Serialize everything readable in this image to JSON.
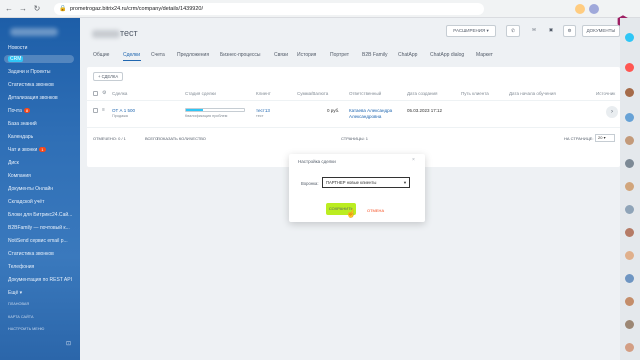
{
  "browser": {
    "url": "prometrogaz.bitrix24.ru/crm/company/details/1439920/"
  },
  "sidebar": {
    "items": [
      {
        "label": "Новости"
      },
      {
        "label": "CRM",
        "tag": "CRM"
      },
      {
        "label": "Задачи и Проекты"
      },
      {
        "label": "Статистика звонков"
      },
      {
        "label": "Детализация звонков"
      },
      {
        "label": "Почта",
        "badge": "8"
      },
      {
        "label": "База знаний"
      },
      {
        "label": "Календарь"
      },
      {
        "label": "Чат и звонки",
        "badge": "1"
      },
      {
        "label": "Диск"
      },
      {
        "label": "Компания"
      },
      {
        "label": "Документы Онлайн"
      },
      {
        "label": "Складской учёт"
      },
      {
        "label": "Блоки для Битрикс24.Сай..."
      },
      {
        "label": "B2BFamily — почтовый к..."
      },
      {
        "label": "NotiSend сервис email р..."
      },
      {
        "label": "Статистика звонков"
      },
      {
        "label": "Телефония"
      },
      {
        "label": "Документация по REST API"
      },
      {
        "label": "Ещё"
      }
    ],
    "footer": [
      "ПЛАНОВАЯ",
      "КАРТА САЙТА",
      "НАСТРОИТЬ МЕНЮ"
    ]
  },
  "header": {
    "title": "тест",
    "extensions_label": "РАСШИРЕНИЯ",
    "documents_label": "ДОКУМЕНТЫ"
  },
  "tabs": [
    "Общие",
    "Сделки",
    "Счета",
    "Предложения",
    "Бизнес-процессы",
    "Связи",
    "История",
    "Портрет",
    "B2B Family",
    "ChatApp",
    "ChatApp dialog",
    "Маркет"
  ],
  "active_tab": "Сделки",
  "deals": {
    "add_label": "СДЕЛКА",
    "columns": [
      "Сделка",
      "Стадия сделки",
      "Клиент",
      "Сумма/Валюта",
      "Ответственный",
      "Дата создания",
      "Путь клиента",
      "Дата начала обучения",
      "Источник"
    ],
    "row": {
      "deal_name": "ОТ А 1 500",
      "deal_sub": "Продажа",
      "stage": "Квалификация проблем",
      "stage_progress": 0.3,
      "client": "тест13",
      "client_sub": "тест",
      "amount": "0 руб.",
      "responsible": "Катаева Александра Александровна",
      "created": "05.03.2023 17:12"
    },
    "footer": {
      "selected": "ОТМЕЧЕНО: 0 / 1",
      "total_label": "ВСЕГО:",
      "show_count": "ПОКАЗАТЬ КОЛИЧЕСТВО",
      "pages": "СТРАНИЦЫ: 1",
      "per_page_label": "НА СТРАНИЦЕ:",
      "per_page": "20"
    }
  },
  "modal": {
    "title": "Настройка сделки",
    "funnel_label": "Воронка:",
    "funnel_value": "ПАРТНЕР новые клиенты",
    "save_label": "СОХРАНИТЬ",
    "cancel_label": "ОТМЕНА"
  },
  "colors": {
    "sidebar": "#2f6fb6",
    "accent": "#2067b0",
    "save": "#bbed21",
    "cancel": "#f54819",
    "brand": "#9e1f63"
  }
}
